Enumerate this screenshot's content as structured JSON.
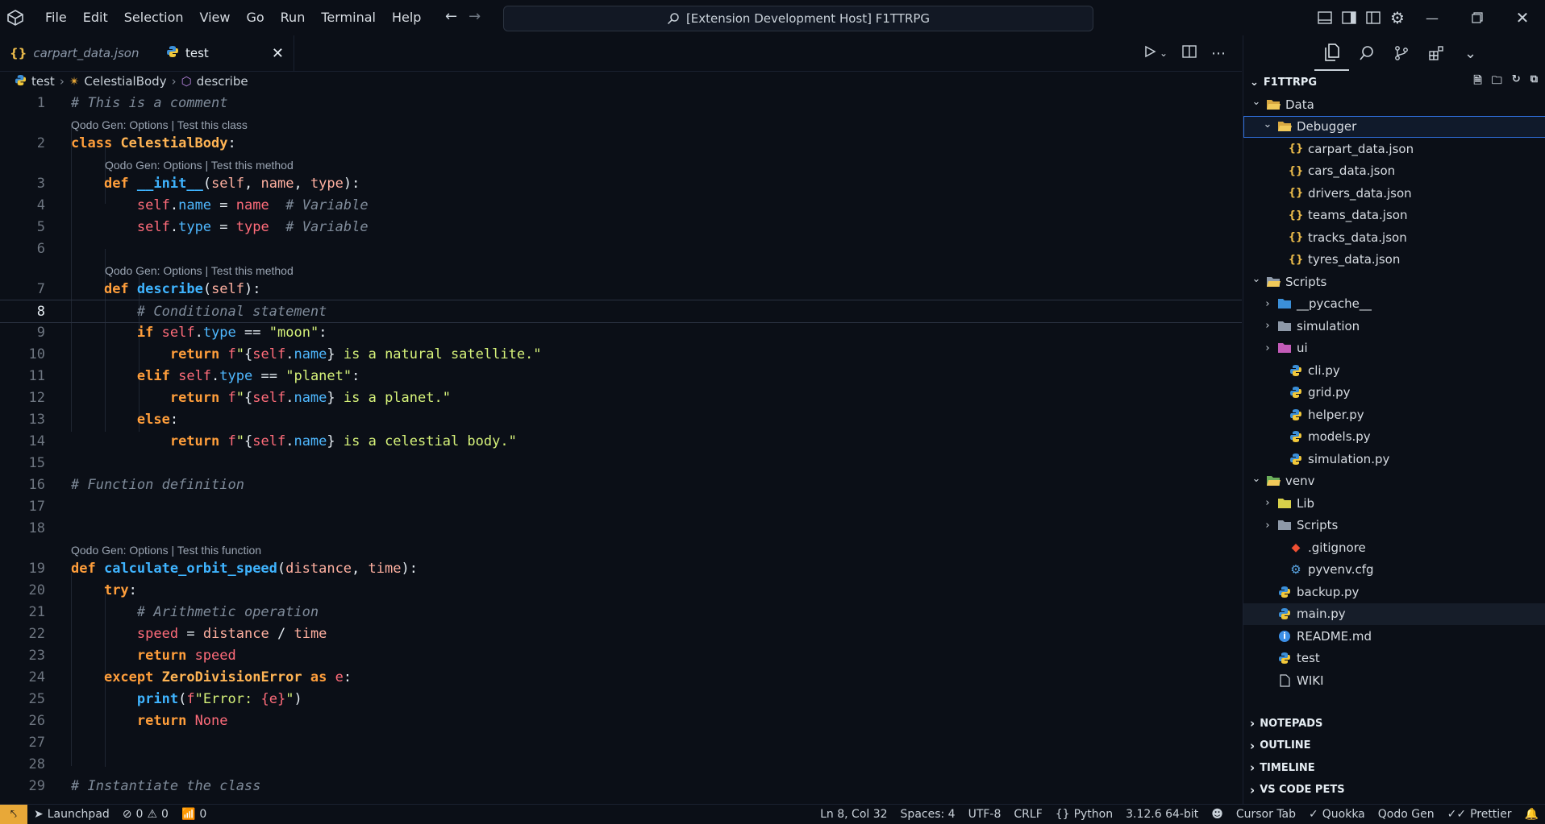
{
  "window": {
    "title": "[Extension Development Host] F1TTRPG"
  },
  "menu": [
    "File",
    "Edit",
    "Selection",
    "View",
    "Go",
    "Run",
    "Terminal",
    "Help"
  ],
  "tabs": [
    {
      "label": "carpart_data.json",
      "type": "json"
    },
    {
      "label": "test",
      "type": "python"
    }
  ],
  "breadcrumb": [
    "test",
    "CelestialBody",
    "describe"
  ],
  "editor": {
    "current_line": 8,
    "lenses": {
      "class": "Qodo Gen: Options | Test this class",
      "method": "Qodo Gen: Options | Test this method",
      "function": "Qodo Gen: Options | Test this function"
    },
    "line_numbers": [
      "1",
      "2",
      "3",
      "4",
      "5",
      "6",
      "7",
      "8",
      "9",
      "10",
      "11",
      "12",
      "13",
      "14",
      "15",
      "16",
      "17",
      "18",
      "19",
      "20",
      "21",
      "22",
      "23",
      "24",
      "25",
      "26",
      "27",
      "28",
      "29"
    ]
  },
  "explorer": {
    "root": "F1TTRPG",
    "items": [
      {
        "label": "Data",
        "depth": 0,
        "kind": "folder-open",
        "chev": "down"
      },
      {
        "label": "Debugger",
        "depth": 1,
        "kind": "folder-open",
        "chev": "down",
        "selected": true
      },
      {
        "label": "carpart_data.json",
        "depth": 2,
        "kind": "json"
      },
      {
        "label": "cars_data.json",
        "depth": 2,
        "kind": "json"
      },
      {
        "label": "drivers_data.json",
        "depth": 2,
        "kind": "json"
      },
      {
        "label": "teams_data.json",
        "depth": 2,
        "kind": "json"
      },
      {
        "label": "tracks_data.json",
        "depth": 2,
        "kind": "json"
      },
      {
        "label": "tyres_data.json",
        "depth": 2,
        "kind": "json"
      },
      {
        "label": "Scripts",
        "depth": 0,
        "kind": "folder-open",
        "chev": "down"
      },
      {
        "label": "__pycache__",
        "depth": 1,
        "kind": "folder",
        "chev": "right"
      },
      {
        "label": "simulation",
        "depth": 1,
        "kind": "folder",
        "chev": "right"
      },
      {
        "label": "ui",
        "depth": 1,
        "kind": "folder",
        "chev": "right"
      },
      {
        "label": "cli.py",
        "depth": 2,
        "kind": "python"
      },
      {
        "label": "grid.py",
        "depth": 2,
        "kind": "python"
      },
      {
        "label": "helper.py",
        "depth": 2,
        "kind": "python"
      },
      {
        "label": "models.py",
        "depth": 2,
        "kind": "python"
      },
      {
        "label": "simulation.py",
        "depth": 2,
        "kind": "python"
      },
      {
        "label": "venv",
        "depth": 0,
        "kind": "folder-open",
        "chev": "down"
      },
      {
        "label": "Lib",
        "depth": 1,
        "kind": "folder",
        "chev": "right"
      },
      {
        "label": "Scripts",
        "depth": 1,
        "kind": "folder",
        "chev": "right"
      },
      {
        "label": ".gitignore",
        "depth": 2,
        "kind": "git"
      },
      {
        "label": "pyvenv.cfg",
        "depth": 2,
        "kind": "cfg"
      },
      {
        "label": "backup.py",
        "depth": 1,
        "kind": "python"
      },
      {
        "label": "main.py",
        "depth": 1,
        "kind": "python",
        "active": true
      },
      {
        "label": "README.md",
        "depth": 1,
        "kind": "info"
      },
      {
        "label": "test",
        "depth": 1,
        "kind": "python"
      },
      {
        "label": "WIKI",
        "depth": 1,
        "kind": "file"
      }
    ],
    "sections": [
      "NOTEPADS",
      "OUTLINE",
      "TIMELINE",
      "VS CODE PETS"
    ]
  },
  "status": {
    "launchpad": "Launchpad",
    "errors": "0",
    "warnings": "0",
    "ports": "0",
    "position": "Ln 8, Col 32",
    "spaces": "Spaces: 4",
    "encoding": "UTF-8",
    "eol": "CRLF",
    "language": "Python",
    "interpreter": "3.12.6 64-bit",
    "cursor_tab": "Cursor Tab",
    "quokka": "Quokka",
    "qodo": "Qodo Gen",
    "prettier": "Prettier"
  },
  "colors": {
    "accent": "#e8a838",
    "selection_outline": "#2f6fdc",
    "background": "#0b0f17"
  }
}
